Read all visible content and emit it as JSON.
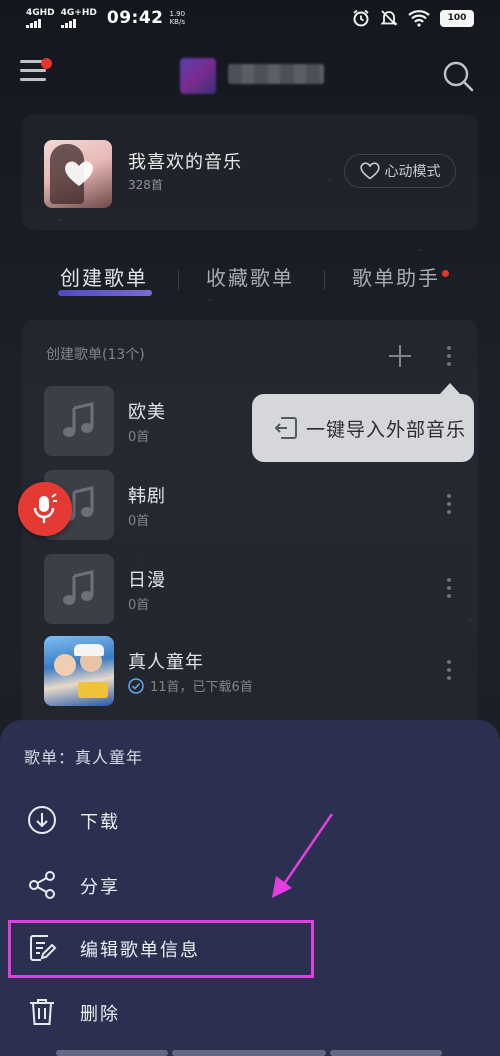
{
  "status_bar": {
    "net1": "4GHD",
    "net2": "4G+HD",
    "time": "09:42",
    "speed_value": "1.90",
    "speed_unit": "KB/s",
    "battery": "100"
  },
  "favorites": {
    "title": "我喜欢的音乐",
    "count": "328首",
    "mode_button": "心动模式"
  },
  "tabs": [
    {
      "label": "创建歌单",
      "active": true
    },
    {
      "label": "收藏歌单",
      "active": false
    },
    {
      "label": "歌单助手",
      "active": false
    }
  ],
  "playlists": {
    "header": "创建歌单(13个)",
    "items": [
      {
        "title": "欧美",
        "sub": "0首"
      },
      {
        "title": "韩剧",
        "sub": "0首"
      },
      {
        "title": "日漫",
        "sub": "0首"
      },
      {
        "title": "真人童年",
        "sub": "11首，已下载6首"
      }
    ]
  },
  "tooltip": {
    "label": "一键导入外部音乐"
  },
  "sheet": {
    "title": "歌单：真人童年",
    "actions": [
      {
        "label": "下载",
        "icon": "download-icon"
      },
      {
        "label": "分享",
        "icon": "share-icon"
      },
      {
        "label": "编辑歌单信息",
        "icon": "edit-icon"
      },
      {
        "label": "删除",
        "icon": "trash-icon"
      }
    ]
  },
  "colors": {
    "accent_red": "#e8332f",
    "sheet_bg": "#2c3050",
    "highlight": "#e43ee0"
  }
}
